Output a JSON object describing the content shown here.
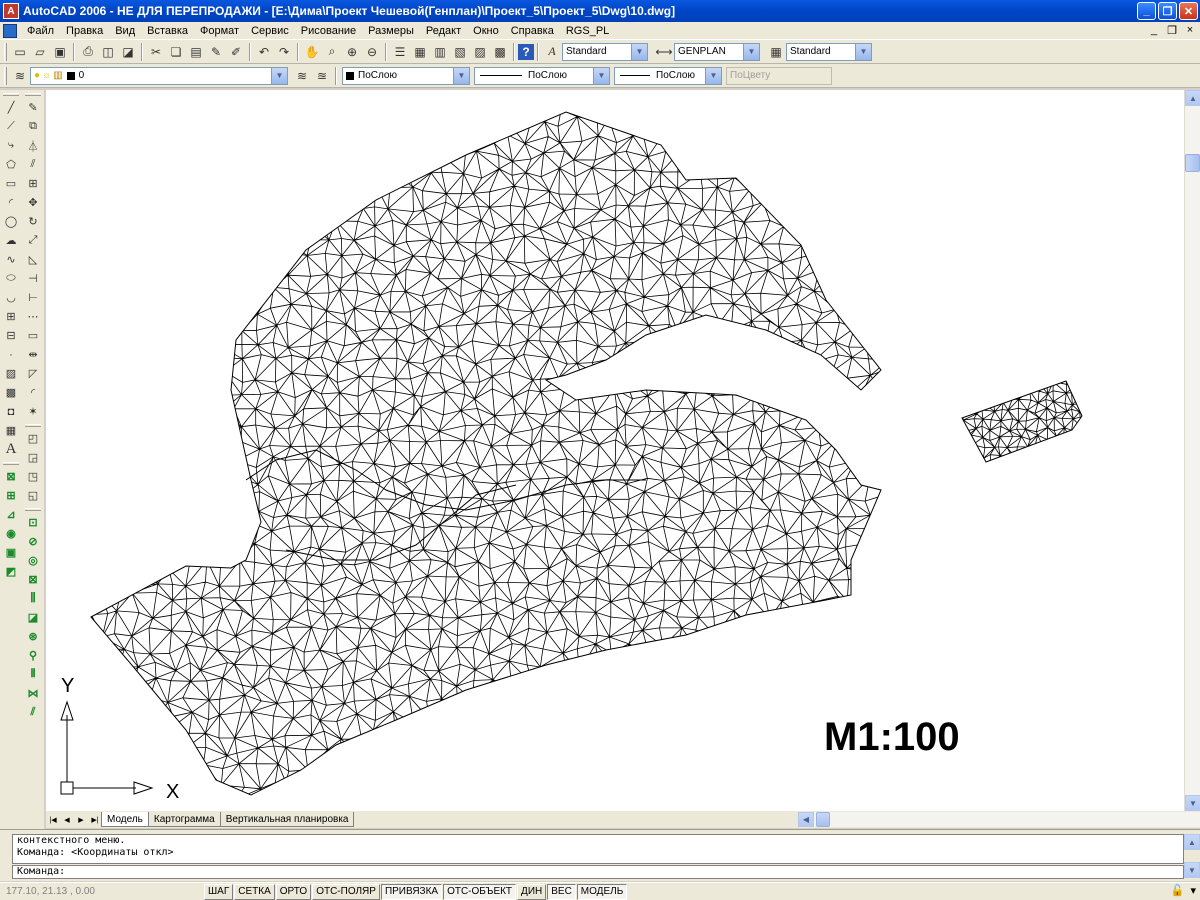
{
  "window": {
    "title": "AutoCAD 2006 - НЕ ДЛЯ ПЕРЕПРОДАЖИ - [E:\\Дима\\Проект Чешевой(Генплан)\\Проект_5\\Проект_5\\Dwg\\10.dwg]",
    "app_icon": "A",
    "min_glyph": "_",
    "max_glyph": "❐",
    "close_glyph": "✕"
  },
  "menu": {
    "items": [
      "Файл",
      "Правка",
      "Вид",
      "Вставка",
      "Формат",
      "Сервис",
      "Рисование",
      "Размеры",
      "Редакт",
      "Окно",
      "Справка",
      "RGS_PL"
    ],
    "mdi": [
      "_",
      "❐",
      "×"
    ]
  },
  "toolbar1": {
    "text_style": "Standard",
    "dim_style": "GENPLAN",
    "table_style": "Standard"
  },
  "toolbar2": {
    "layer": "0",
    "color": "ПоСлою",
    "linetype": "ПоСлою",
    "lineweight": "ПоСлою",
    "plotstyle": "ПоЦвету"
  },
  "drawing": {
    "scale_label": "M1:100",
    "ucs_x": "X",
    "ucs_y": "Y"
  },
  "tabs": {
    "items": [
      "Модель",
      "Картограмма",
      "Вертикальная планировка"
    ],
    "active": "Модель"
  },
  "command": {
    "history": [
      "контекстного меню.",
      "Команда:  <Координаты откл>"
    ],
    "prompt": "Команда:"
  },
  "status": {
    "coords": "177.10, 21.13 , 0.00",
    "buttons": [
      "ШАГ",
      "СЕТКА",
      "ОРТО",
      "ОТС-ПОЛЯР",
      "ПРИВЯЗКА",
      "ОТС-ОБЪЕКТ",
      "ДИН",
      "ВЕС",
      "МОДЕЛЬ"
    ],
    "pressed": [
      "ПРИВЯЗКА",
      "ОТС-ОБЪЕКТ",
      "ВЕС",
      "МОДЕЛЬ"
    ]
  },
  "colors": {
    "titlebar": "#0046c8",
    "chrome": "#ece9d8",
    "canvas": "#ffffff",
    "mesh": "#000000"
  }
}
